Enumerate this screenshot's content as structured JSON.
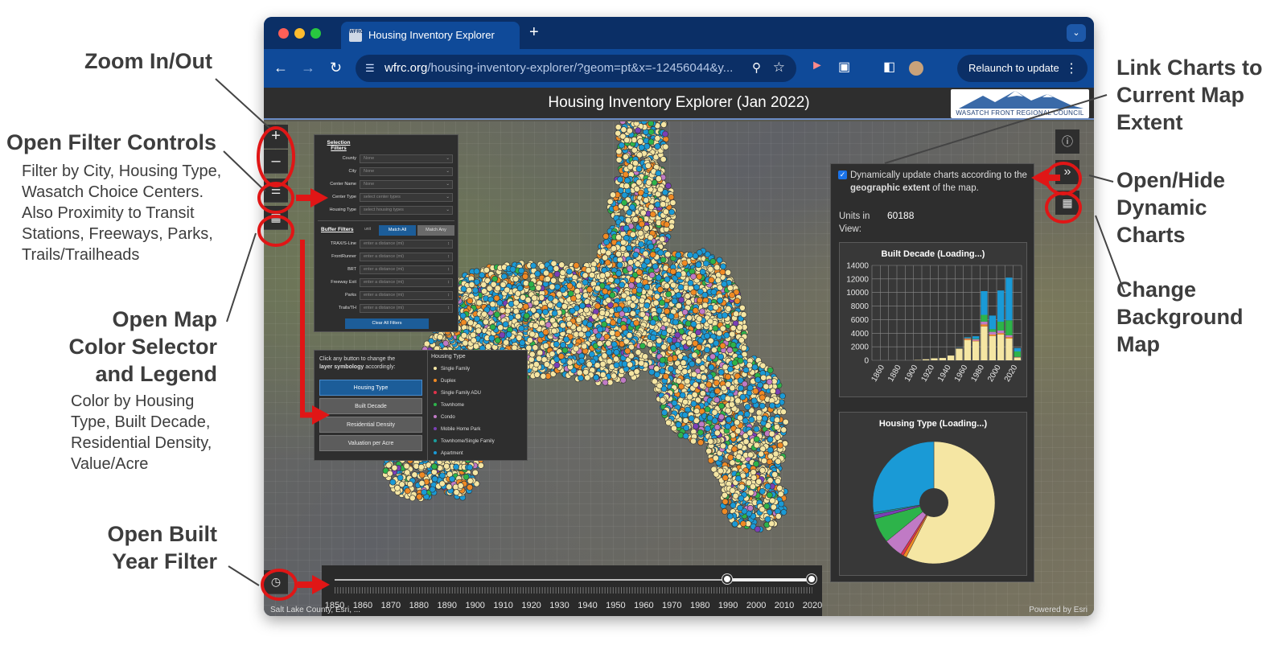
{
  "annotations": {
    "zoom": "Zoom In/Out",
    "filter_title": "Open Filter Controls",
    "filter_desc": [
      "Filter by City, Housing Type,",
      "Wasatch Choice Centers.",
      "Also Proximity to Transit",
      "Stations, Freeways, Parks,",
      "Trails/Trailheads"
    ],
    "color_title": [
      "Open Map",
      "Color Selector",
      "and Legend"
    ],
    "color_desc": [
      "Color by Housing",
      "Type, Built Decade,",
      "Residential Density,",
      "Value/Acre"
    ],
    "built_title": [
      "Open Built",
      "Year Filter"
    ],
    "link_title": [
      "Link Charts to",
      "Current Map",
      "Extent"
    ],
    "openhide_title": [
      "Open/Hide",
      "Dynamic",
      "Charts"
    ],
    "background_title": [
      "Change",
      "Background",
      "Map"
    ]
  },
  "browser": {
    "tab_title": "Housing Inventory Explorer",
    "favicon_text": "WFRC",
    "url_host": "wfrc.org",
    "url_path": "/housing-inventory-explorer/?geom=pt&x=-12456044&y...",
    "relaunch": "Relaunch to update"
  },
  "app": {
    "title": "Housing Inventory Explorer (Jan 2022)",
    "logo_text": "WASATCH FRONT REGIONAL COUNCIL",
    "attribution_left": "Salt Lake County, Esri, ...",
    "attribution_right": "Powered by Esri"
  },
  "filters": {
    "selection_title": "Selection Filters",
    "selection": [
      {
        "label": "County",
        "value": "None"
      },
      {
        "label": "City",
        "value": "None"
      },
      {
        "label": "Center Name",
        "value": "None"
      },
      {
        "label": "Center Type",
        "value": "select center types"
      },
      {
        "label": "Housing Type",
        "value": "select housing types"
      }
    ],
    "buffer_title": "Buffer Filters",
    "buffer_unit": "unit",
    "match_all": "Match All",
    "match_any": "Match Any",
    "buffer": [
      {
        "label": "TRAX/S-Line",
        "value": "enter a distance (mi)"
      },
      {
        "label": "FrontRunner",
        "value": "enter a distance (mi)"
      },
      {
        "label": "BRT",
        "value": "enter a distance (mi)"
      },
      {
        "label": "Freeway Exit",
        "value": "enter a distance (mi)"
      },
      {
        "label": "Parks",
        "value": "enter a distance (mi)"
      },
      {
        "label": "Trails/TH",
        "value": "enter a distance (mi)"
      }
    ],
    "clear": "Clear All Filters"
  },
  "legend": {
    "intro_a": "Click any button to change the",
    "intro_b_bold": "layer symbology",
    "intro_b": " accordingly:",
    "buttons": [
      "Housing Type",
      "Built Decade",
      "Residential Density",
      "Valuation per Acre"
    ],
    "active_button": "Housing Type",
    "list_title": "Housing Type",
    "items": [
      {
        "label": "Single Family",
        "color": "#f5e6a3"
      },
      {
        "label": "Duplex",
        "color": "#f08a24"
      },
      {
        "label": "Single Family ADU",
        "color": "#e0324b"
      },
      {
        "label": "Townhome",
        "color": "#2db34a"
      },
      {
        "label": "Condo",
        "color": "#c07ac5"
      },
      {
        "label": "Mobile Home Park",
        "color": "#7a3fb5"
      },
      {
        "label": "Townhome/Single Family",
        "color": "#1a9e9e"
      },
      {
        "label": "Apartment",
        "color": "#1a9ad6"
      }
    ]
  },
  "timeline": {
    "years": [
      "1850",
      "1860",
      "1870",
      "1880",
      "1890",
      "1900",
      "1910",
      "1920",
      "1930",
      "1940",
      "1950",
      "1960",
      "1970",
      "1980",
      "1990",
      "2000",
      "2010",
      "2020"
    ],
    "range_start": 1990,
    "range_end": 2020
  },
  "charts_panel": {
    "checkbox_text_a": "Dynamically update charts according to the ",
    "checkbox_text_bold": "geographic extent",
    "checkbox_text_b": " of the map.",
    "units_label": "Units in View:",
    "units_value": "60188"
  },
  "chart_data": [
    {
      "type": "bar",
      "title": "Built Decade (Loading...)",
      "categories": [
        "1850",
        "1860",
        "1870",
        "1880",
        "1890",
        "1900",
        "1910",
        "1920",
        "1930",
        "1940",
        "1950",
        "1960",
        "1970",
        "1980",
        "1990",
        "2000",
        "2010",
        "2020"
      ],
      "tick_labels": [
        "1860",
        "1880",
        "1900",
        "1920",
        "1940",
        "1960",
        "1980",
        "2000",
        "2020"
      ],
      "ylim": [
        0,
        14000
      ],
      "yticks": [
        0,
        2000,
        4000,
        6000,
        8000,
        10000,
        12000,
        14000
      ],
      "grid": true,
      "series": [
        {
          "color": "#f5e6a3",
          "values": [
            0,
            0,
            0,
            0,
            0,
            50,
            150,
            300,
            350,
            700,
            1700,
            3000,
            2800,
            5000,
            3600,
            3800,
            3200,
            400
          ]
        },
        {
          "color": "#f08a24",
          "values": [
            0,
            0,
            0,
            0,
            0,
            0,
            0,
            0,
            0,
            0,
            50,
            150,
            100,
            300,
            200,
            200,
            200,
            50
          ]
        },
        {
          "color": "#c07ac5",
          "values": [
            0,
            0,
            0,
            0,
            0,
            0,
            0,
            0,
            0,
            0,
            0,
            100,
            200,
            400,
            400,
            400,
            300,
            50
          ]
        },
        {
          "color": "#2db34a",
          "values": [
            0,
            0,
            0,
            0,
            0,
            0,
            0,
            0,
            0,
            0,
            0,
            50,
            100,
            1000,
            400,
            1300,
            2200,
            800
          ]
        },
        {
          "color": "#1a9ad6",
          "values": [
            0,
            0,
            0,
            0,
            0,
            0,
            0,
            0,
            0,
            0,
            50,
            100,
            350,
            3500,
            2000,
            4600,
            6300,
            500
          ]
        }
      ]
    },
    {
      "type": "pie",
      "title": "Housing Type (Loading...)",
      "donut": true,
      "slices": [
        {
          "color": "#f5e6a3",
          "value": 52
        },
        {
          "color": "#f08a24",
          "value": 0.8
        },
        {
          "color": "#e0324b",
          "value": 0.7
        },
        {
          "color": "#c07ac5",
          "value": 4.5
        },
        {
          "color": "#2db34a",
          "value": 6
        },
        {
          "color": "#7a3fb5",
          "value": 1
        },
        {
          "color": "#1a9e9e",
          "value": 0.5
        },
        {
          "color": "#1a9ad6",
          "value": 25
        }
      ]
    }
  ]
}
